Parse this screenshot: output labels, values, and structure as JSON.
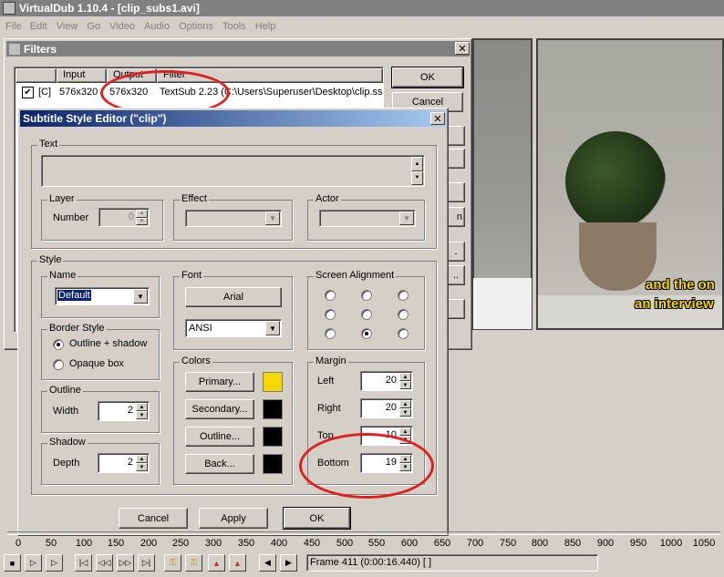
{
  "main_window": {
    "title": "VirtualDub 1.10.4 - [clip_subs1.avi]",
    "menu": [
      "File",
      "Edit",
      "View",
      "Go",
      "Video",
      "Audio",
      "Options",
      "Tools",
      "Help"
    ]
  },
  "filters_dialog": {
    "title": "Filters",
    "columns": [
      "Input",
      "Output",
      "Filter"
    ],
    "row": {
      "checked": "✔",
      "flag": "[C]",
      "input": "576x320",
      "output": "576x320",
      "filter": "TextSub 2.23 (C:\\Users\\Superuser\\Desktop\\clip.ss"
    },
    "ok_label": "OK",
    "cancel_label": "Cancel"
  },
  "editor": {
    "title": "Subtitle Style Editor (\"clip\")",
    "text_group": "Text",
    "layer_group": "Layer",
    "number_label": "Number",
    "number_value": "0",
    "effect_group": "Effect",
    "actor_group": "Actor",
    "style_group": "Style",
    "name_group": "Name",
    "name_value": "Default",
    "border_group": "Border Style",
    "border_opt1": "Outline + shadow",
    "border_opt2": "Opaque box",
    "outline_group": "Outline",
    "width_label": "Width",
    "width_value": "2",
    "shadow_group": "Shadow",
    "depth_label": "Depth",
    "depth_value": "2",
    "font_group": "Font",
    "font_button": "Arial",
    "charset_value": "ANSI",
    "colors_group": "Colors",
    "primary_label": "Primary...",
    "secondary_label": "Secondary...",
    "outline_label": "Outline...",
    "back_label": "Back...",
    "align_group": "Screen Alignment",
    "margin_group": "Margin",
    "left_label": "Left",
    "left_value": "20",
    "right_label": "Right",
    "right_value": "20",
    "top_label": "Top",
    "top_value": "10",
    "bottom_label": "Bottom",
    "bottom_value": "19",
    "cancel_label": "Cancel",
    "apply_label": "Apply",
    "ok_label": "OK"
  },
  "colors": {
    "primary": "#f5d800",
    "secondary": "#000000",
    "outline": "#000000",
    "back": "#000000",
    "title_active": "#0a246a",
    "title_inactive": "#808080",
    "annotation": "#e02020"
  },
  "video": {
    "subtitle_line1": "and the on",
    "subtitle_line2": "an interview"
  },
  "timeline": {
    "ticks": [
      "0",
      "50",
      "100",
      "150",
      "200",
      "250",
      "300",
      "350",
      "400",
      "450",
      "500",
      "550",
      "600",
      "650",
      "700",
      "750",
      "800",
      "850",
      "900",
      "950",
      "1000",
      "1050"
    ],
    "frame_status": "Frame 411 (0:00:16.440) [ ]"
  }
}
